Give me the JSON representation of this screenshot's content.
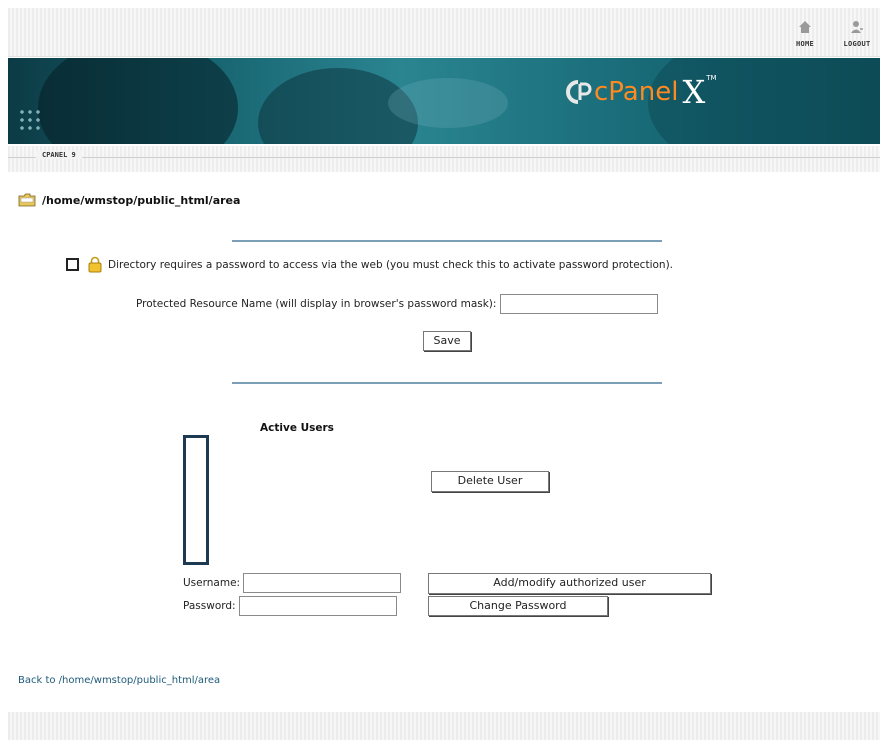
{
  "topnav": {
    "home_label": "HOME",
    "logout_label": "LOGOUT"
  },
  "banner": {
    "logo_text": "cPanel",
    "logo_x": "X",
    "logo_tm": "TM"
  },
  "breadcrumb": "CPANEL 9",
  "path": "/home/wmstop/public_html/area",
  "protect": {
    "checkbox_label": "Directory requires a password to access via the web (you must check this to activate password protection).",
    "checked": false,
    "resource_label": "Protected Resource Name (will display in browser's password mask):",
    "resource_value": "",
    "save_label": "Save"
  },
  "users": {
    "title": "Active Users",
    "items": [],
    "delete_label": "Delete User",
    "username_label": "Username:",
    "username_value": "",
    "add_label": "Add/modify authorized user",
    "password_label": "Password:",
    "password_value": "",
    "change_label": "Change Password"
  },
  "back_link": "Back to /home/wmstop/public_html/area",
  "colors": {
    "banner": "#1f7581",
    "logo_orange": "#ff8a1f",
    "divider": "#7aa0b8",
    "link": "#1e5a78"
  }
}
